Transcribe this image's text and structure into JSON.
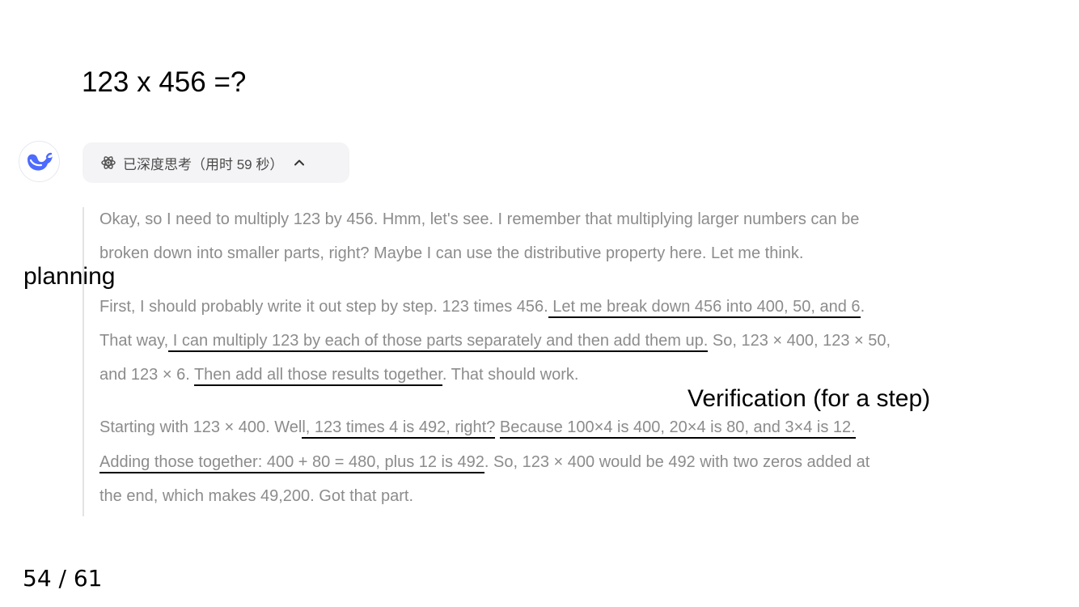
{
  "question": "123 x 456 =?",
  "think_toggle": {
    "label": "已深度思考（用时 59 秒）",
    "atom_icon": "atom-icon",
    "chevron_icon": "chevron-up-icon"
  },
  "avatar": {
    "icon": "whale-logo-icon",
    "color": "#4d6bfe"
  },
  "thoughts": {
    "p1": {
      "l1": "Okay, so I need to multiply 123 by 456. Hmm, let's see. I remember that multiplying larger numbers can be",
      "l2": "broken down into smaller parts, right? Maybe I can use the distributive property here. Let me think."
    },
    "p2": {
      "l1a": "First, I should probably write it out step by step. 123 times 456.",
      "l1b": " Let me break down 456 into 400, 50, and 6",
      "l1c": ".",
      "l2a": "That way,",
      "l2b": " I can multiply 123 by each of those parts separately and then add them up.",
      "l2c": " So, 123 × 400, 123 × 50,",
      "l3a": "and 123 × 6. ",
      "l3b": "Then add all those results together",
      "l3c": ". That should work."
    },
    "p3": {
      "l1a": "Starting with 123 × 400. Wel",
      "l1b": "l, 123 times 4 is 492, right?",
      "l1c": " ",
      "l1d": "Because 100×4 is 400, 20×4 is 80, and 3×4 is 12.  ",
      "l2a": "Adding those together: 400 + 80 = 480, plus 12 is 492",
      "l2b": ". So, 123 × 400 would be 492 with two zeros added at",
      "l3": "the end, which makes 49,200. Got that part."
    }
  },
  "annotations": {
    "planning": "planning",
    "verification": "Verification (for a step)"
  },
  "slide_counter": "54 / 61"
}
